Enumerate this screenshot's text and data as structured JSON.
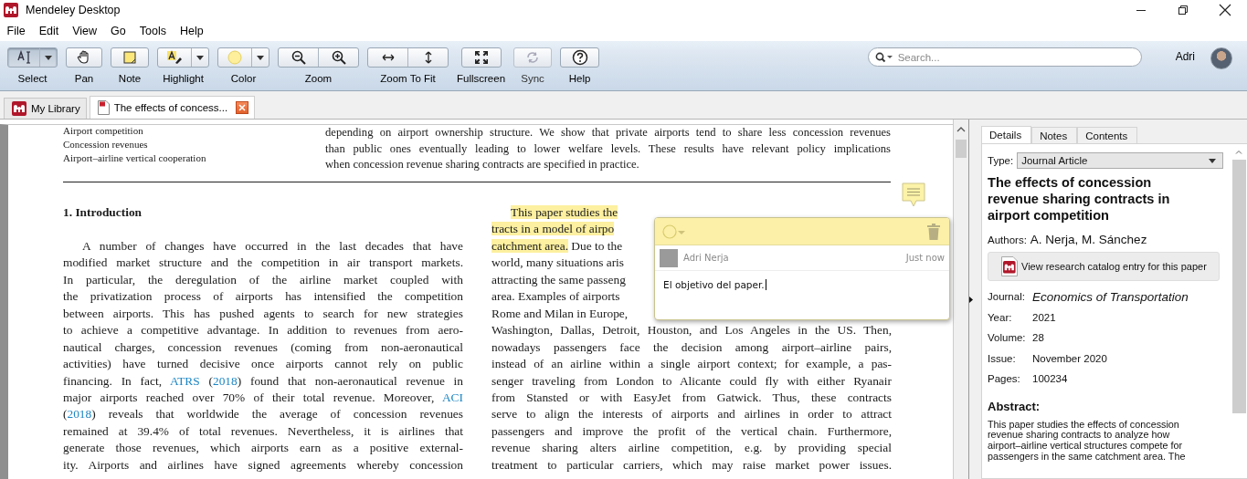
{
  "window": {
    "title": "Mendeley Desktop"
  },
  "menu": [
    "File",
    "Edit",
    "View",
    "Go",
    "Tools",
    "Help"
  ],
  "toolbar": [
    {
      "label": "Select",
      "kind": "select",
      "dropdown": true,
      "selected": true,
      "disabled": false
    },
    {
      "label": "Pan",
      "kind": "pan",
      "dropdown": false,
      "selected": false,
      "disabled": false
    },
    {
      "label": "Note",
      "kind": "note",
      "dropdown": false,
      "selected": false,
      "disabled": false
    },
    {
      "label": "Highlight",
      "kind": "highlight",
      "dropdown": true,
      "selected": false,
      "disabled": false
    },
    {
      "label": "Color",
      "kind": "color",
      "dropdown": true,
      "selected": false,
      "disabled": false
    },
    {
      "label": "Zoom",
      "kind": "zoom",
      "dropdown": false,
      "selected": false,
      "disabled": false
    },
    {
      "label": "Zoom To Fit",
      "kind": "fit",
      "dropdown": false,
      "selected": false,
      "disabled": false
    },
    {
      "label": "Fullscreen",
      "kind": "fullscreen",
      "dropdown": false,
      "selected": false,
      "disabled": false
    },
    {
      "label": "Sync",
      "kind": "sync",
      "dropdown": false,
      "selected": false,
      "disabled": true
    },
    {
      "label": "Help",
      "kind": "help",
      "dropdown": false,
      "selected": false,
      "disabled": false
    }
  ],
  "search": {
    "placeholder": "Search..."
  },
  "user": {
    "name": "Adri"
  },
  "tabs": [
    {
      "label": "My Library",
      "kind": "library",
      "selected": false
    },
    {
      "label": "The effects of concess...",
      "kind": "pdf",
      "selected": true
    }
  ],
  "document": {
    "keywords": [
      "Airport competition",
      "Concession revenues",
      "Airport–airline vertical cooperation"
    ],
    "abstract_lines": [
      {
        "text": "depending on airport ownership structure. We show that private airports tend to share less concession revenues",
        "justified": true
      },
      {
        "text": "than public ones eventually leading to lower welfare levels. These results have relevant policy implications",
        "justified": true
      },
      {
        "text": "when concession revenue sharing contracts are specified in practice.",
        "justified": false
      }
    ],
    "heading": "1.  Introduction",
    "left_lines": [
      {
        "segments": [
          {
            "text": "A number of changes have occurred in the last decades that have",
            "kind": "plain"
          }
        ],
        "justified": true,
        "indent": true
      },
      {
        "segments": [
          {
            "text": "modified market structure and the competition in air transport markets.",
            "kind": "plain"
          }
        ],
        "justified": true,
        "indent": false
      },
      {
        "segments": [
          {
            "text": "In particular, the deregulation of the airline market coupled with",
            "kind": "plain"
          }
        ],
        "justified": true,
        "indent": false
      },
      {
        "segments": [
          {
            "text": "the privatization process of airports has intensified the competition",
            "kind": "plain"
          }
        ],
        "justified": true,
        "indent": false
      },
      {
        "segments": [
          {
            "text": "between airports. This has pushed agents to search for new strategies",
            "kind": "plain"
          }
        ],
        "justified": true,
        "indent": false
      },
      {
        "segments": [
          {
            "text": "to achieve a competitive advantage. In addition to revenues from aero-",
            "kind": "plain"
          }
        ],
        "justified": true,
        "indent": false
      },
      {
        "segments": [
          {
            "text": "nautical charges, concession revenues (coming from non-aeronautical",
            "kind": "plain"
          }
        ],
        "justified": true,
        "indent": false
      },
      {
        "segments": [
          {
            "text": "activities) have turned decisive once airports cannot rely on public",
            "kind": "plain"
          }
        ],
        "justified": true,
        "indent": false
      },
      {
        "segments": [
          {
            "text": "financing. In fact, ",
            "kind": "plain"
          },
          {
            "text": "ATRS",
            "kind": "link"
          },
          {
            "text": " (",
            "kind": "plain"
          },
          {
            "text": "2018",
            "kind": "link"
          },
          {
            "text": ") found that non-aeronautical revenue in",
            "kind": "plain"
          }
        ],
        "justified": true,
        "indent": false
      },
      {
        "segments": [
          {
            "text": "major airports reached over 70% of their total revenue. Moreover, ",
            "kind": "plain"
          },
          {
            "text": "ACI",
            "kind": "link"
          }
        ],
        "justified": true,
        "indent": false
      },
      {
        "segments": [
          {
            "text": "(",
            "kind": "plain"
          },
          {
            "text": "2018",
            "kind": "link"
          },
          {
            "text": ") reveals that worldwide the average of concession revenues",
            "kind": "plain"
          }
        ],
        "justified": true,
        "indent": false
      },
      {
        "segments": [
          {
            "text": "remained at 39.4% of total revenues. Nevertheless, it is airlines that",
            "kind": "plain"
          }
        ],
        "justified": true,
        "indent": false
      },
      {
        "segments": [
          {
            "text": "generate those revenues, which airports earn as a positive external-",
            "kind": "plain"
          }
        ],
        "justified": true,
        "indent": false
      },
      {
        "segments": [
          {
            "text": "ity. Airports and airlines have signed agreements whereby concession",
            "kind": "plain"
          }
        ],
        "justified": true,
        "indent": false
      }
    ],
    "right_lines": [
      {
        "segments": [
          {
            "text": "This paper studies the",
            "kind": "highlight"
          }
        ],
        "justified": false,
        "indent": true
      },
      {
        "segments": [
          {
            "text": "tracts in a model of airpo",
            "kind": "highlight"
          }
        ],
        "justified": false,
        "indent": false
      },
      {
        "segments": [
          {
            "text": "catchment area.",
            "kind": "highlight"
          },
          {
            "text": " Due to the",
            "kind": "plain"
          }
        ],
        "justified": false,
        "indent": false
      },
      {
        "segments": [
          {
            "text": "world, many situations aris",
            "kind": "plain"
          }
        ],
        "justified": false,
        "indent": false
      },
      {
        "segments": [
          {
            "text": "attracting the same passeng",
            "kind": "plain"
          }
        ],
        "justified": false,
        "indent": false
      },
      {
        "segments": [
          {
            "text": "area. Examples of airports",
            "kind": "plain"
          }
        ],
        "justified": false,
        "indent": false
      },
      {
        "segments": [
          {
            "text": "Rome and Milan in Europe,",
            "kind": "plain"
          }
        ],
        "justified": false,
        "indent": false
      },
      {
        "segments": [
          {
            "text": "Washington, Dallas, Detroit, Houston, and Los Angeles in the US. Then,",
            "kind": "plain"
          }
        ],
        "justified": true,
        "indent": false
      },
      {
        "segments": [
          {
            "text": "nowadays passengers face the decision among airport–airline pairs,",
            "kind": "plain"
          }
        ],
        "justified": true,
        "indent": false
      },
      {
        "segments": [
          {
            "text": "instead of an airline within a single airport context; for example, a pas-",
            "kind": "plain"
          }
        ],
        "justified": true,
        "indent": false
      },
      {
        "segments": [
          {
            "text": "senger traveling from London to Alicante could fly with either Ryanair",
            "kind": "plain"
          }
        ],
        "justified": true,
        "indent": false
      },
      {
        "segments": [
          {
            "text": "from Stansted or with EasyJet from Gatwick. Thus, these contracts",
            "kind": "plain"
          }
        ],
        "justified": true,
        "indent": false
      },
      {
        "segments": [
          {
            "text": "serve to align the interests of airports and airlines in order to attract",
            "kind": "plain"
          }
        ],
        "justified": true,
        "indent": false
      },
      {
        "segments": [
          {
            "text": "passengers and improve the profit of the vertical chain. Furthermore,",
            "kind": "plain"
          }
        ],
        "justified": true,
        "indent": false
      },
      {
        "segments": [
          {
            "text": "revenue sharing alters airline competition, e.g. by providing special",
            "kind": "plain"
          }
        ],
        "justified": true,
        "indent": false
      },
      {
        "segments": [
          {
            "text": "treatment to particular carriers, which may raise market power issues.",
            "kind": "plain"
          }
        ],
        "justified": true,
        "indent": false
      }
    ]
  },
  "note": {
    "author": "Adri Nerja",
    "time": "Just now",
    "text": "El objetivo del paper."
  },
  "details": {
    "tabs": [
      {
        "label": "Details",
        "selected": true
      },
      {
        "label": "Notes",
        "selected": false
      },
      {
        "label": "Contents",
        "selected": false
      }
    ],
    "type_label": "Type:",
    "type_value": "Journal Article",
    "title": "The effects of concession revenue sharing contracts in airport competition",
    "authors_label": "Authors:",
    "authors": "A. Nerja, M. Sánchez",
    "catalog_button": "View research catalog entry for this paper",
    "fields": [
      {
        "label": "Journal:",
        "value": "Economics of Transportation",
        "kind": "journal"
      },
      {
        "label": "Year:",
        "value": "2021",
        "kind": "plain"
      },
      {
        "label": "Volume:",
        "value": "28",
        "kind": "plain"
      },
      {
        "label": "Issue:",
        "value": "November 2020",
        "kind": "plain"
      },
      {
        "label": "Pages:",
        "value": "100234",
        "kind": "plain"
      }
    ],
    "abstract_heading": "Abstract:",
    "abstract_lines": [
      "This paper studies the effects of concession",
      "revenue sharing contracts to analyze how",
      "airport–airline vertical structures compete for",
      "passengers in the same catchment area. The"
    ]
  }
}
